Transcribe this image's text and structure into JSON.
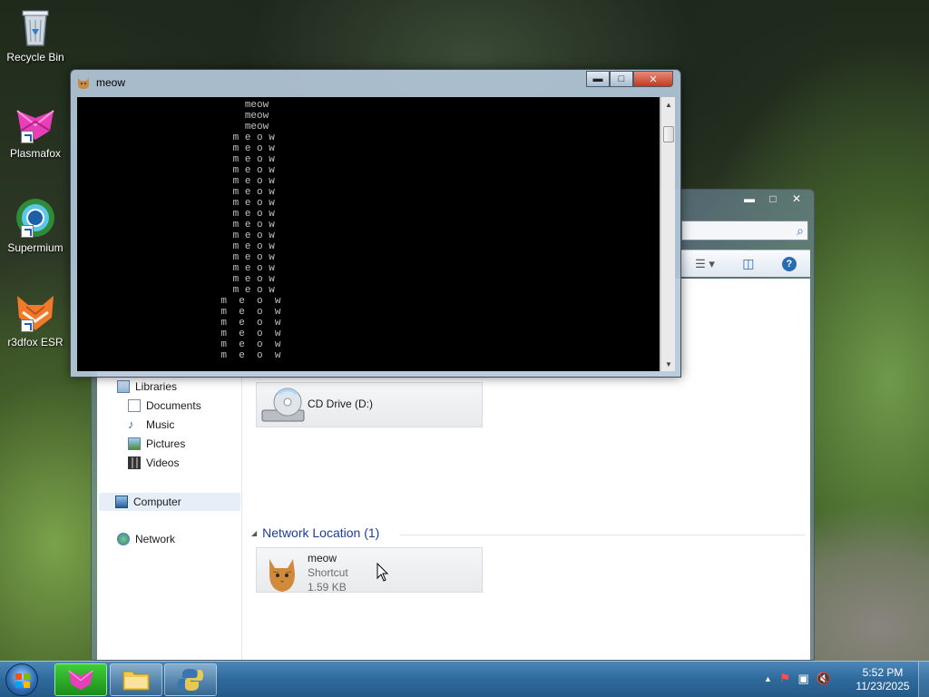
{
  "desktop": {
    "icons": [
      {
        "label": "Recycle Bin"
      },
      {
        "label": "Plasmafox"
      },
      {
        "label": "Supermium"
      },
      {
        "label": "r3dfox ESR"
      }
    ]
  },
  "console": {
    "title": "meow",
    "lines": [
      "                            meow",
      "                            meow",
      "                            meow",
      "                          m e o w",
      "                          m e o w",
      "                          m e o w",
      "                          m e o w",
      "                          m e o w",
      "                          m e o w",
      "                          m e o w",
      "                          m e o w",
      "                          m e o w",
      "                          m e o w",
      "                          m e o w",
      "                          m e o w",
      "                          m e o w",
      "                          m e o w",
      "                          m e o w",
      "                        m  e  o  w",
      "                        m  e  o  w",
      "                        m  e  o  w",
      "                        m  e  o  w",
      "                        m  e  o  w",
      "                        m  e  o  w"
    ]
  },
  "explorer": {
    "nav": {
      "libraries": "Libraries",
      "documents": "Documents",
      "music": "Music",
      "pictures": "Pictures",
      "videos": "Videos",
      "computer": "Computer",
      "network": "Network"
    },
    "cd_drive": "CD Drive (D:)",
    "network_group": "Network Location (1)",
    "network_item": {
      "name": "meow",
      "type": "Shortcut",
      "size": "1.59 KB"
    }
  },
  "taskbar": {
    "time": "5:52 PM",
    "date": "11/23/2025"
  }
}
